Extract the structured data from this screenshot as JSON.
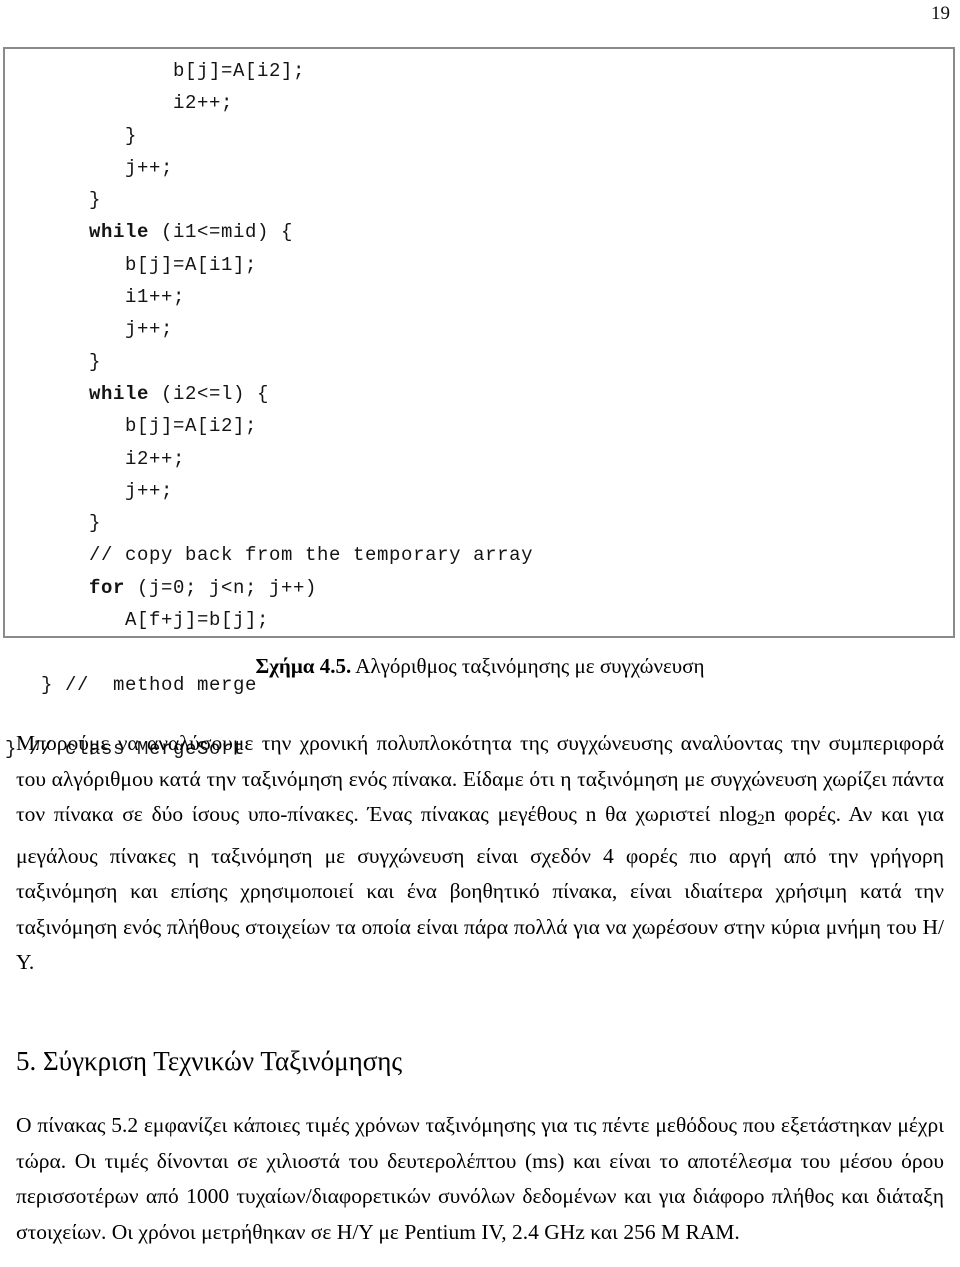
{
  "page": {
    "number": "19"
  },
  "code_block": {
    "language": "java",
    "lines": [
      {
        "indent": 14,
        "text": "b[j]=A[i2];",
        "keyword": ""
      },
      {
        "indent": 14,
        "text": "i2++;",
        "keyword": ""
      },
      {
        "indent": 10,
        "text": "}",
        "keyword": ""
      },
      {
        "indent": 10,
        "text": "j++;",
        "keyword": ""
      },
      {
        "indent": 7,
        "text": "}",
        "keyword": ""
      },
      {
        "indent": 7,
        "text": " (i1<=mid) {",
        "keyword": "while"
      },
      {
        "indent": 10,
        "text": "b[j]=A[i1];",
        "keyword": ""
      },
      {
        "indent": 10,
        "text": "i1++;",
        "keyword": ""
      },
      {
        "indent": 10,
        "text": "j++;",
        "keyword": ""
      },
      {
        "indent": 7,
        "text": "}",
        "keyword": ""
      },
      {
        "indent": 7,
        "text": " (i2<=l) {",
        "keyword": "while"
      },
      {
        "indent": 10,
        "text": "b[j]=A[i2];",
        "keyword": ""
      },
      {
        "indent": 10,
        "text": "i2++;",
        "keyword": ""
      },
      {
        "indent": 10,
        "text": "j++;",
        "keyword": ""
      },
      {
        "indent": 7,
        "text": "}",
        "keyword": ""
      },
      {
        "indent": 7,
        "text": "// copy back from the temporary array",
        "keyword": ""
      },
      {
        "indent": 7,
        "text": " (j=0; j<n; j++)",
        "keyword": "for"
      },
      {
        "indent": 10,
        "text": "A[f+j]=b[j];",
        "keyword": ""
      },
      {
        "indent": 0,
        "text": "",
        "keyword": ""
      },
      {
        "indent": 3,
        "text": "} //  method merge",
        "keyword": ""
      },
      {
        "indent": 0,
        "text": "",
        "keyword": ""
      },
      {
        "indent": 0,
        "text": "} // class MergeSort",
        "keyword": ""
      }
    ]
  },
  "figure": {
    "label": "Σχήμα 4.5.",
    "caption": " Αλγόριθμος ταξινόμησης με συγχώνευση"
  },
  "paragraph_1": {
    "part_a": "Μπορούμε να αναλύσουμε την χρονική πολυπλοκότητα της συγχώνευσης αναλύοντας την συμπεριφορά του αλγόριθμου κατά την ταξινόμηση ενός πίνακα. Είδαμε ότι η ταξινόμηση με συγχώνευση χωρίζει πάντα τον πίνακα σε δύο ίσους υπο-πίνακες. Ένας πίνακας μεγέθους n θα χωριστεί nlog",
    "subscript": "2",
    "part_b": "n φορές. Αν και για μεγάλους πίνακες η ταξινόμηση με συγχώνευση είναι σχεδόν 4 φορές πιο αργή από την γρήγορη ταξινόμηση και επίσης χρησιμοποιεί και ένα βοηθητικό πίνακα, είναι ιδιαίτερα χρήσιμη κατά την ταξινόμηση ενός πλήθους στοιχείων τα οποία είναι πάρα πολλά για να χωρέσουν στην κύρια μνήμη του Η/Υ."
  },
  "section": {
    "heading": "5. Σύγκριση Τεχνικών Ταξινόμησης"
  },
  "paragraph_2": {
    "text": "Ο πίνακας 5.2 εμφανίζει κάποιες τιμές χρόνων ταξινόμησης για τις πέντε μεθόδους που εξετάστηκαν μέχρι τώρα. Οι τιμές δίνονται σε χιλιοστά του δευτερολέπτου (ms) και είναι το αποτέλεσμα του μέσου όρου περισσοτέρων από 1000 τυχαίων/διαφορετικών συνόλων δεδομένων και για διάφορο πλήθος και διάταξη στοιχείων. Οι χρόνοι μετρήθηκαν σε Η/Υ με Pentium IV, 2.4 GHz και 256 M RAM."
  },
  "colors": {
    "text": "#000000",
    "code_border": "#8a8a8a",
    "background": "#ffffff"
  }
}
